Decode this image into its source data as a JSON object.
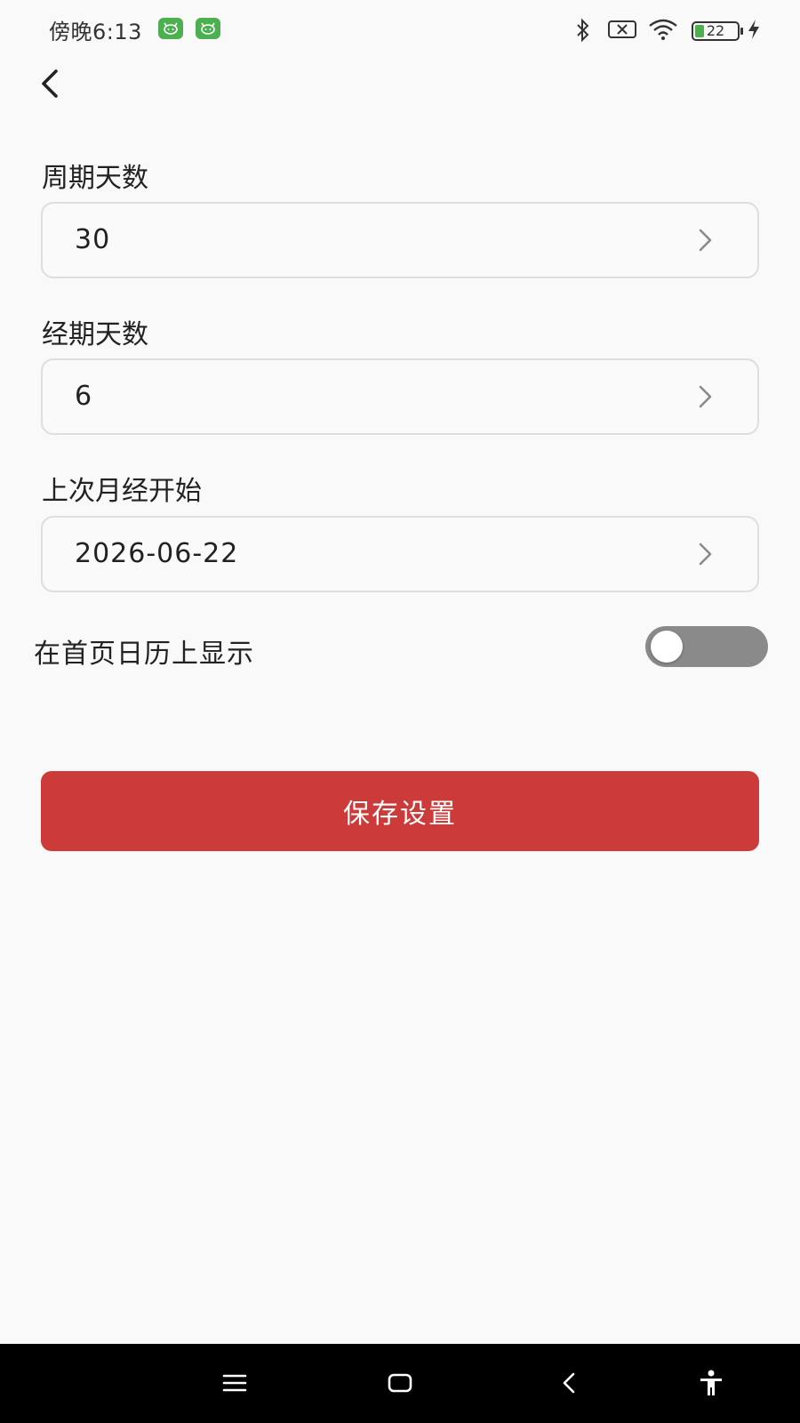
{
  "status_bar": {
    "time": "傍晚6:13",
    "battery_level": "22",
    "icons": [
      "app-icon",
      "app-icon",
      "bluetooth-icon",
      "no-sim-icon",
      "wifi-icon",
      "battery-icon",
      "charging-icon"
    ]
  },
  "header": {
    "back_icon": "chevron-left-icon"
  },
  "form": {
    "cycle_days": {
      "label": "周期天数",
      "value": "30"
    },
    "period_days": {
      "label": "经期天数",
      "value": "6"
    },
    "last_period_start": {
      "label": "上次月经开始",
      "value": "2026-06-22"
    },
    "show_on_calendar": {
      "label": "在首页日历上显示",
      "enabled": false
    }
  },
  "actions": {
    "save_label": "保存设置",
    "save_color": "#cd3a3a"
  },
  "nav_bar": {
    "icons": [
      "menu-icon",
      "home-icon",
      "back-icon",
      "accessibility-icon"
    ]
  }
}
